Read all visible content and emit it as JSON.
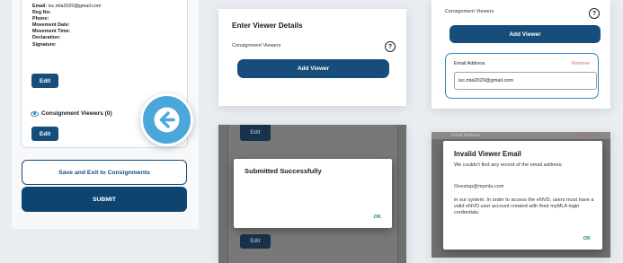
{
  "panel1": {
    "details": [
      {
        "label": "Email:",
        "value": " isc.mla2020@gmail.com"
      },
      {
        "label": "Reg No:",
        "value": ""
      },
      {
        "label": "Phone:",
        "value": ""
      },
      {
        "label": "Movement Date:",
        "value": ""
      },
      {
        "label": "Movement Time:",
        "value": ""
      },
      {
        "label": "Declaration:",
        "value": ""
      },
      {
        "label": "Signature:",
        "value": ""
      }
    ],
    "edit_label": "Edit",
    "consignment_viewers_label": "Consignment Viewers (0)",
    "edit2_label": "Edit",
    "save_exit_label": "Save and Exit to Consignments",
    "submit_label": "SUBMIT"
  },
  "panel2": {
    "title": "Enter Viewer Details",
    "viewers_label": "Consignment Viewers",
    "help_glyph": "?",
    "add_viewer_label": "Add Viewer"
  },
  "panel3": {
    "viewers_label": "Consignment Viewers",
    "help_glyph": "?",
    "add_viewer_label": "Add Viewer",
    "email_label": "Email Address",
    "remove_label": "Remove",
    "email_value": "isc.mla2020@gmail.com"
  },
  "panel4": {
    "edit_top_label": "Edit",
    "dialog_title": "Submitted Successfully",
    "ok_label": "OK",
    "edit_bottom_label": "Edit"
  },
  "panel5": {
    "bg_email_label": "Email Address",
    "bg_remove_label": "Remove",
    "dialog_title": "Invalid Viewer Email",
    "line1": "We couldn't find any record of the email address:",
    "email": "Onestop@mymla.com",
    "body": "in our system. In order to access the eNVD, users must have a valid eNVD user account created with their myMLA login credentials.",
    "ok_label": "OK"
  },
  "colors": {
    "primary": "#164d7a",
    "accent": "#2f88c6",
    "remove": "#e06b5f",
    "ok": "#1a8a4a"
  }
}
